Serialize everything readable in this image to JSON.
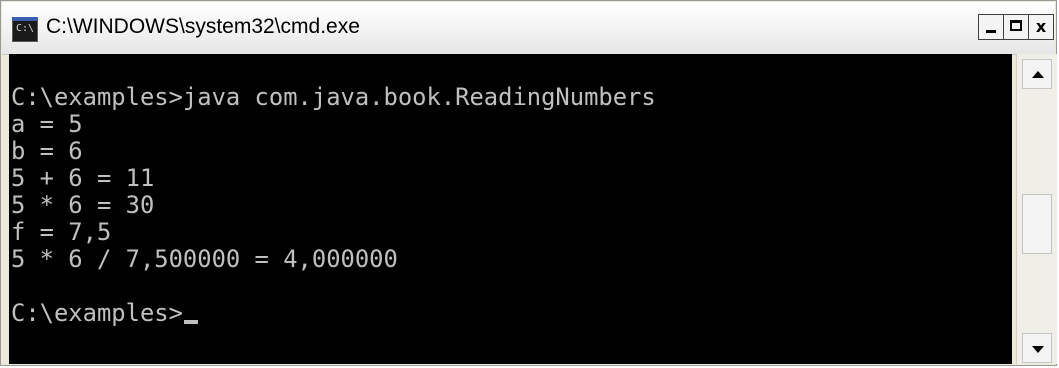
{
  "window": {
    "title": "C:\\WINDOWS\\system32\\cmd.exe",
    "icon": "cmd-app-icon"
  },
  "controls": {
    "minimize": "minimize-icon",
    "maximize": "maximize-icon",
    "close": "close-icon",
    "close_glyph": "x"
  },
  "console": {
    "lines": [
      "C:\\examples>java com.java.book.ReadingNumbers",
      "a = 5",
      "b = 6",
      "5 + 6 = 11",
      "5 * 6 = 30",
      "f = 7,5",
      "5 * 6 / 7,500000 = 4,000000",
      "",
      "C:\\examples>"
    ]
  },
  "colors": {
    "console_bg": "#000000",
    "console_text": "#c0c0c0",
    "titlebar_text": "#000000"
  }
}
